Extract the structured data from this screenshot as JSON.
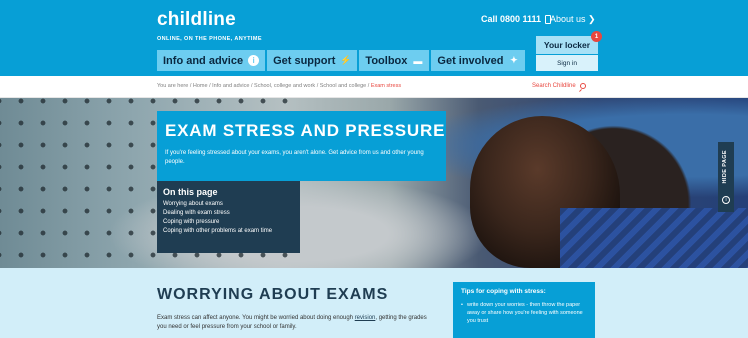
{
  "header": {
    "logo": "childline",
    "tagline": "ONLINE, ON THE PHONE, ANYTIME",
    "call": "Call 0800 1111",
    "about": "About us ❯",
    "locker": "Your locker",
    "locker_badge": "1",
    "signin": "Sign in",
    "nav": [
      {
        "label": "Info and advice",
        "icon": "info-icon"
      },
      {
        "label": "Get support",
        "icon": "lightning-icon"
      },
      {
        "label": "Toolbox",
        "icon": "toolbox-icon"
      },
      {
        "label": "Get involved",
        "icon": "star-icon"
      }
    ]
  },
  "breadcrumb": {
    "text": "You are here / Home / Info and advice / School, college and work / School and college / ",
    "current": "Exam stress",
    "search": "Search Childline"
  },
  "hero": {
    "title": "EXAM STRESS AND PRESSURE",
    "intro": "If you're feeling stressed about your exams, you aren't alone. Get advice from us and other young people.",
    "onpage_title": "On this page",
    "onpage_links": [
      "Worrying about exams",
      "Dealing with exam stress",
      "Coping with pressure",
      "Coping with other problems at exam time"
    ],
    "hide_page": "HIDE PAGE",
    "info": "i"
  },
  "content": {
    "heading": "WORRYING ABOUT EXAMS",
    "body_before": "Exam stress can affect anyone. You might be worried about doing enough ",
    "body_link": "revision",
    "body_after": ", getting the grades you need or feel pressure from your school or family."
  },
  "tips": {
    "title": "Tips for coping with stress:",
    "items": [
      "write down your worries - then throw the paper away or share how you're feeling with someone you trust"
    ]
  },
  "colors": {
    "brand_blue": "#079fd6",
    "nav_light": "#6dcdf0",
    "navy": "#1f3d52",
    "accent_red": "#e8473f",
    "content_bg": "#d2eef9"
  }
}
